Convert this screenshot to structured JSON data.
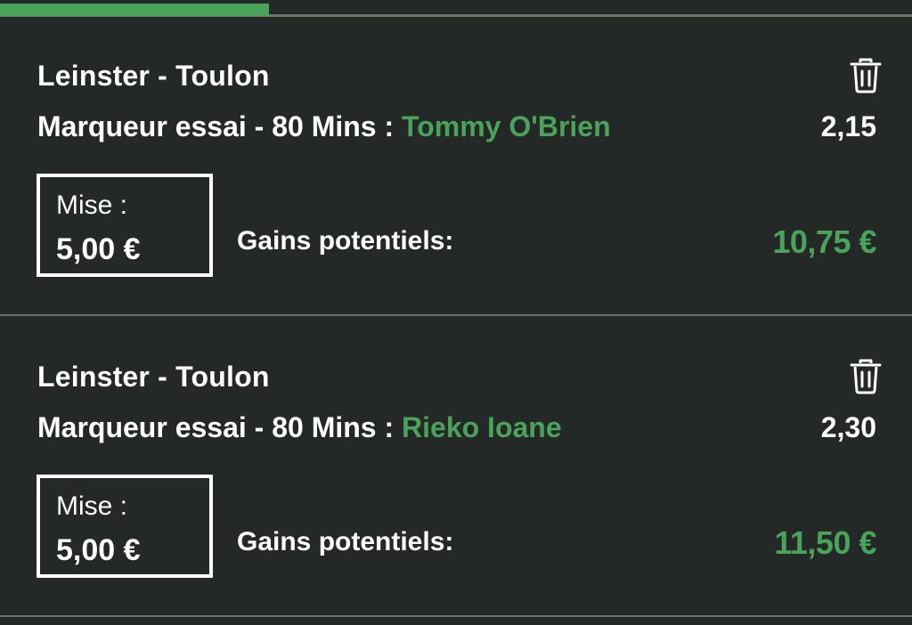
{
  "progress": {
    "fraction": 0.295,
    "color": "#4aa35a"
  },
  "bets": [
    {
      "match": "Leinster - Toulon",
      "market": "Marqueur essai - 80 Mins : ",
      "selection": "Tommy O'Brien",
      "odds": "2,15",
      "stake_label": "Mise :",
      "stake_value": "5,00 €",
      "gains_label": "Gains potentiels:",
      "gains_value": "10,75 €",
      "delete_icon": "trash-icon"
    },
    {
      "match": "Leinster - Toulon",
      "market": "Marqueur essai - 80 Mins : ",
      "selection": "Rieko Ioane",
      "odds": "2,30",
      "stake_label": "Mise :",
      "stake_value": "5,00 €",
      "gains_label": "Gains potentiels:",
      "gains_value": "11,50 €",
      "delete_icon": "trash-icon"
    }
  ],
  "colors": {
    "background": "#242826",
    "accent": "#4aa35a",
    "text": "#ffffff",
    "divider": "#6b6f6c"
  }
}
